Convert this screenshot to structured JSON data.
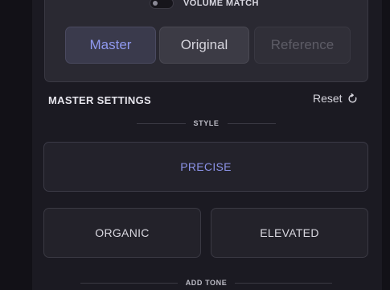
{
  "compare": {
    "volume_match_label": "VOLUME MATCH",
    "volume_match_on": false,
    "segments": [
      {
        "label": "Master",
        "state": "active"
      },
      {
        "label": "Original",
        "state": "normal"
      },
      {
        "label": "Reference",
        "state": "disabled"
      }
    ]
  },
  "master_settings": {
    "title": "MASTER SETTINGS",
    "reset_label": "Reset",
    "reset_icon": "reset-icon",
    "style_label": "STYLE",
    "styles": [
      {
        "label": "PRECISE",
        "selected": true
      },
      {
        "label": "ORGANIC",
        "selected": false
      },
      {
        "label": "ELEVATED",
        "selected": false
      }
    ],
    "add_tone_label": "ADD TONE"
  },
  "colors": {
    "accent": "#8f98ee",
    "background": "#1b1a22",
    "card": "#23222a"
  }
}
